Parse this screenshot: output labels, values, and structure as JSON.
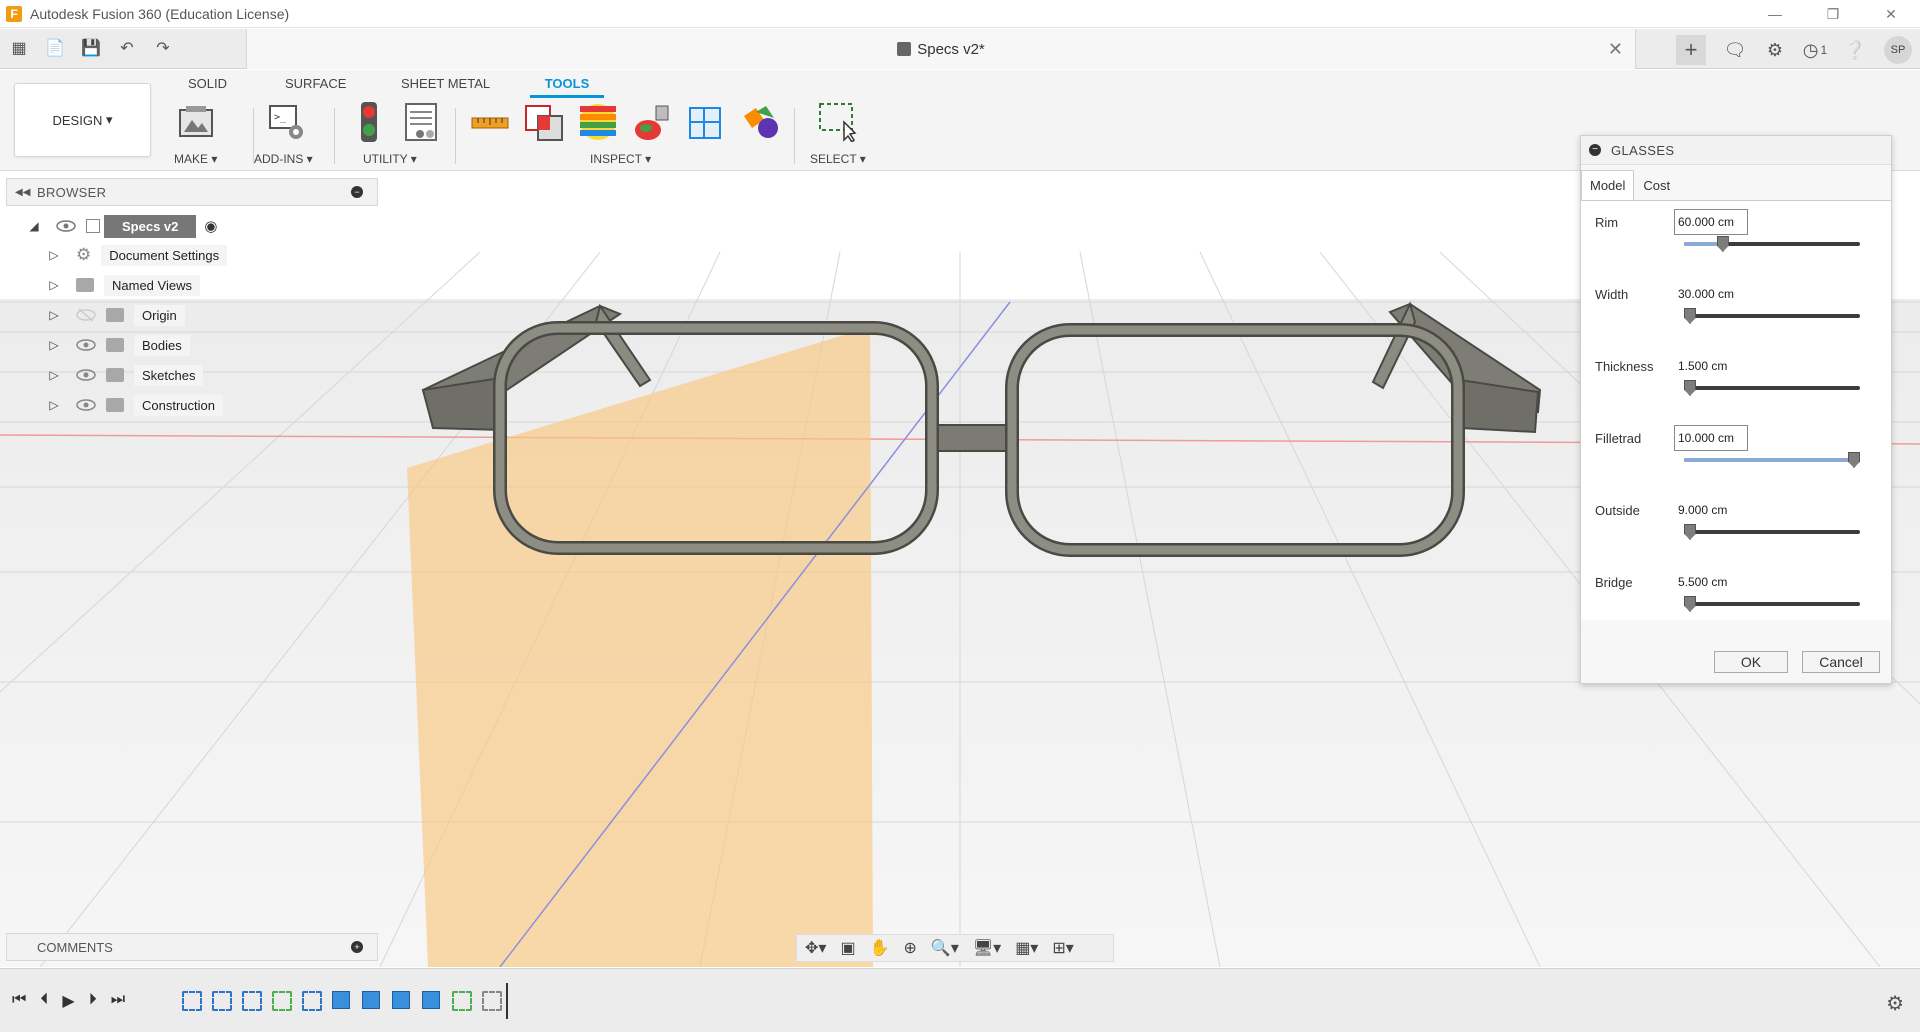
{
  "window": {
    "title": "Autodesk Fusion 360 (Education License)",
    "app_icon": "F",
    "controls": [
      "minimize",
      "restore",
      "close"
    ]
  },
  "quickbar": {
    "document_title": "Specs v2*",
    "avatar_initials": "SP",
    "jobs_count": "1"
  },
  "toolbar": {
    "workspace": "DESIGN",
    "tabs": [
      "SOLID",
      "SURFACE",
      "SHEET METAL",
      "TOOLS"
    ],
    "active_tab": "TOOLS",
    "groups": [
      "MAKE",
      "ADD-INS",
      "UTILITY",
      "INSPECT",
      "SELECT"
    ]
  },
  "browser": {
    "title": "BROWSER",
    "root": "Specs v2",
    "items": [
      {
        "label": "Document Settings",
        "icon": "gear-icon"
      },
      {
        "label": "Named Views",
        "icon": "folder-icon"
      },
      {
        "label": "Origin",
        "icon": "folder-icon"
      },
      {
        "label": "Bodies",
        "icon": "folder-icon"
      },
      {
        "label": "Sketches",
        "icon": "folder-icon"
      },
      {
        "label": "Construction",
        "icon": "folder-icon"
      }
    ]
  },
  "comments": {
    "title": "COMMENTS"
  },
  "dialog": {
    "title": "GLASSES",
    "tabs": [
      "Model",
      "Cost"
    ],
    "active_tab": "Model",
    "params": [
      {
        "label": "Rim",
        "value": "60.000 cm",
        "slider": 0.2
      },
      {
        "label": "Width",
        "value": "30.000 cm",
        "slider": 0.0
      },
      {
        "label": "Thickness",
        "value": "1.500 cm",
        "slider": 0.0
      },
      {
        "label": "Filletrad",
        "value": "10.000 cm",
        "slider": 1.0
      },
      {
        "label": "Outside",
        "value": "9.000 cm",
        "slider": 0.0
      },
      {
        "label": "Bridge",
        "value": "5.500 cm",
        "slider": 0.0
      }
    ],
    "ok_label": "OK",
    "cancel_label": "Cancel"
  },
  "colors": {
    "accent": "#0696d7",
    "frame": "#6e6e66",
    "origin_plane": "#f9c77f",
    "slider_fill": "#8aa8d8"
  }
}
